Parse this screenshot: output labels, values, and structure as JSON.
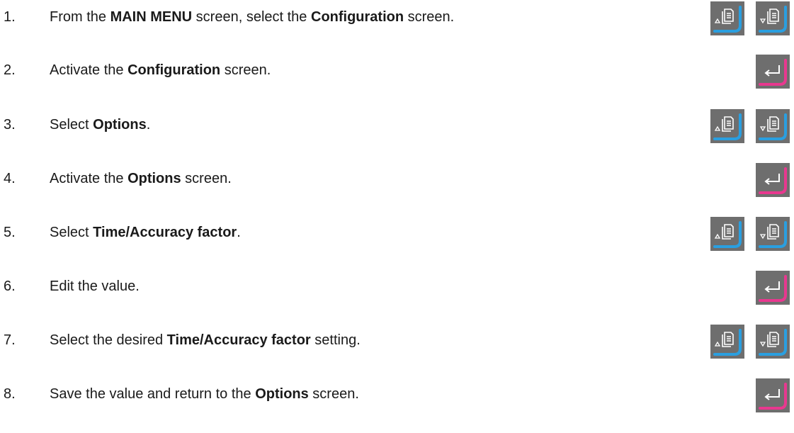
{
  "steps": [
    {
      "number": "1.",
      "parts": [
        {
          "t": "From the ",
          "b": false
        },
        {
          "t": "MAIN MENU",
          "b": true
        },
        {
          "t": " screen, select the ",
          "b": false
        },
        {
          "t": "Configuration",
          "b": true
        },
        {
          "t": " screen.",
          "b": false
        }
      ],
      "buttons": [
        "page-up",
        "page-down"
      ]
    },
    {
      "number": "2.",
      "parts": [
        {
          "t": "Activate the ",
          "b": false
        },
        {
          "t": "Configuration",
          "b": true
        },
        {
          "t": " screen.",
          "b": false
        }
      ],
      "buttons": [
        "enter"
      ]
    },
    {
      "number": "3.",
      "parts": [
        {
          "t": "Select ",
          "b": false
        },
        {
          "t": "Options",
          "b": true
        },
        {
          "t": ".",
          "b": false
        }
      ],
      "buttons": [
        "page-up",
        "page-down"
      ]
    },
    {
      "number": "4.",
      "parts": [
        {
          "t": "Activate the ",
          "b": false
        },
        {
          "t": "Options",
          "b": true
        },
        {
          "t": " screen.",
          "b": false
        }
      ],
      "buttons": [
        "enter"
      ]
    },
    {
      "number": "5.",
      "parts": [
        {
          "t": "Select ",
          "b": false
        },
        {
          "t": "Time/Accuracy factor",
          "b": true
        },
        {
          "t": ".",
          "b": false
        }
      ],
      "buttons": [
        "page-up",
        "page-down"
      ]
    },
    {
      "number": "6.",
      "parts": [
        {
          "t": "Edit the value.",
          "b": false
        }
      ],
      "buttons": [
        "enter"
      ]
    },
    {
      "number": "7.",
      "parts": [
        {
          "t": "Select the desired ",
          "b": false
        },
        {
          "t": "Time/Accuracy factor",
          "b": true
        },
        {
          "t": " setting.",
          "b": false
        }
      ],
      "buttons": [
        "page-up",
        "page-down"
      ]
    },
    {
      "number": "8.",
      "parts": [
        {
          "t": "Save the value and return to the ",
          "b": false
        },
        {
          "t": "Options",
          "b": true
        },
        {
          "t": " screen.",
          "b": false
        }
      ],
      "buttons": [
        "enter"
      ]
    }
  ],
  "colors": {
    "button_bg": "#6e6e6e",
    "nav_accent": "#2a9fe0",
    "enter_accent": "#e8388f",
    "icon": "#ffffff"
  }
}
